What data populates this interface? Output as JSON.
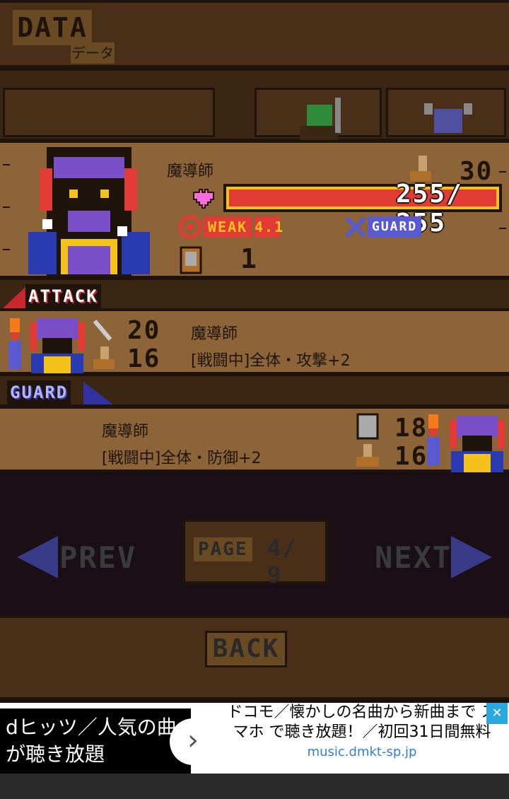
{
  "header": {
    "title": "DATA",
    "subtitle": "データ"
  },
  "main_card": {
    "name": "魔導師",
    "speed": "30",
    "hp_current": "255",
    "hp_max": "255",
    "hp_text": "255/ 255",
    "weak_label": "WEAK",
    "weak_value": "4.1",
    "guard_label": "GUARD",
    "card_count": "1"
  },
  "attack": {
    "section_label": "ATTACK",
    "power": "20",
    "speed": "16",
    "name": "魔導師",
    "effect": "[戦闘中]全体・攻撃+2"
  },
  "guard": {
    "section_label": "GUARD",
    "defense": "18",
    "speed": "16",
    "name": "魔導師",
    "effect": "[戦闘中]全体・防御+2"
  },
  "nav": {
    "prev": "PREV",
    "next": "NEXT",
    "page_label": "PAGE",
    "page_text": "4/ 9"
  },
  "back_label": "BACK",
  "ad": {
    "left_text": "dヒッツ／人気の曲が聴き放題",
    "right_text": "ドコモ／懐かしの名曲から新曲まで スマホ で聴き放題！／初回31日間無料",
    "url": "music.dmkt-sp.jp",
    "close": "✕",
    "arrow": "›"
  },
  "colors": {
    "hp_red": "#e23a35",
    "gold": "#f4c21a",
    "guard_blue": "#5a5ad0",
    "wood": "#8c6437"
  }
}
